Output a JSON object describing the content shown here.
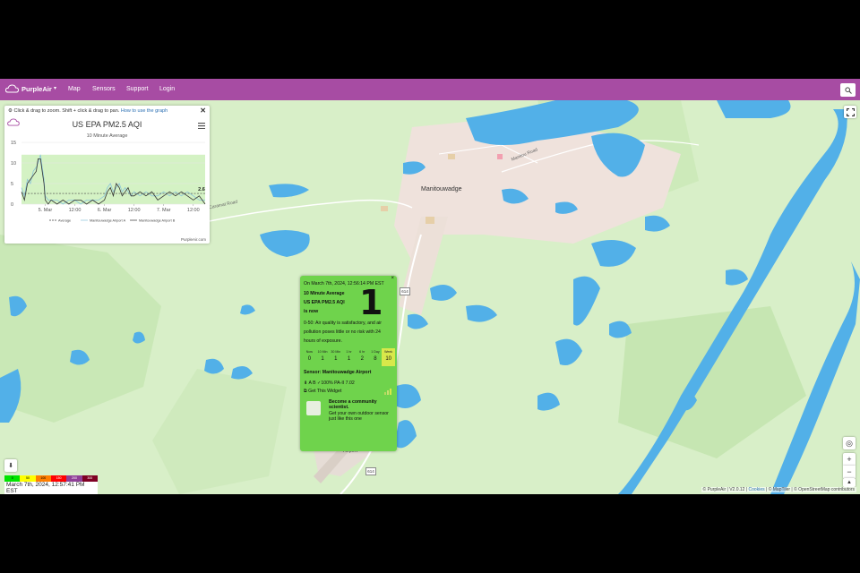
{
  "navbar": {
    "brand": "PurpleAir",
    "items": [
      "Map",
      "Sensors",
      "Support",
      "Login"
    ]
  },
  "chart_panel": {
    "hint": "Click & drag to zoom. Shift + click & drag to pan.",
    "hint_link": "How to use the graph",
    "title": "US EPA PM2.5 AQI",
    "subtitle": "10 Minute Average",
    "credit": "PurpleAir.com",
    "legend": [
      "Average",
      "Manitouwadge Airport A",
      "Manitouwadge Airport B"
    ],
    "last_value_label": "2.6"
  },
  "chart_data": {
    "type": "line",
    "title": "US EPA PM2.5 AQI",
    "subtitle": "10 Minute Average",
    "xlabel": "",
    "ylabel": "",
    "ylim": [
      0,
      15
    ],
    "yticks": [
      0,
      5,
      10,
      15
    ],
    "xticks": [
      "5. Mar",
      "12:00",
      "6. Mar",
      "12:00",
      "7. Mar",
      "12:00"
    ],
    "xlim": [
      -0.4,
      2.7
    ],
    "good_band": [
      0,
      12
    ],
    "average": 2.6,
    "series": [
      {
        "name": "Manitouwadge Airport A",
        "x": [
          -0.4,
          -0.35,
          -0.3,
          -0.25,
          -0.2,
          -0.15,
          -0.12,
          -0.08,
          -0.05,
          -0.02,
          0.0,
          0.05,
          0.1,
          0.2,
          0.3,
          0.4,
          0.5,
          0.6,
          0.7,
          0.8,
          0.9,
          1.0,
          1.05,
          1.1,
          1.15,
          1.2,
          1.25,
          1.3,
          1.35,
          1.4,
          1.45,
          1.5,
          1.6,
          1.7,
          1.8,
          1.9,
          2.0,
          2.1,
          2.2,
          2.3,
          2.4,
          2.5,
          2.6,
          2.7
        ],
        "values": [
          4,
          2,
          6,
          5,
          8,
          9,
          10,
          12,
          9,
          6,
          2,
          1,
          1,
          1,
          0,
          1,
          1,
          0,
          1,
          1,
          1,
          2,
          4,
          5,
          3,
          4,
          5,
          3,
          4,
          3,
          2,
          3,
          2,
          3,
          2,
          2,
          3,
          2,
          3,
          2,
          3,
          2,
          1,
          1
        ]
      },
      {
        "name": "Manitouwadge Airport B",
        "x": [
          -0.4,
          -0.35,
          -0.3,
          -0.25,
          -0.2,
          -0.15,
          -0.12,
          -0.08,
          -0.05,
          -0.02,
          0.0,
          0.05,
          0.1,
          0.2,
          0.3,
          0.4,
          0.5,
          0.6,
          0.7,
          0.8,
          0.9,
          1.0,
          1.05,
          1.1,
          1.15,
          1.2,
          1.25,
          1.3,
          1.35,
          1.4,
          1.45,
          1.5,
          1.6,
          1.7,
          1.8,
          1.9,
          2.0,
          2.1,
          2.2,
          2.3,
          2.4,
          2.5,
          2.6,
          2.7
        ],
        "values": [
          3,
          1,
          5,
          6,
          7,
          8,
          11,
          11,
          8,
          5,
          1,
          0,
          1,
          0,
          1,
          0,
          1,
          1,
          0,
          1,
          0,
          1,
          3,
          4,
          2,
          5,
          4,
          2,
          3,
          4,
          2,
          2,
          3,
          2,
          3,
          1,
          2,
          3,
          2,
          3,
          2,
          1,
          2,
          0
        ]
      }
    ]
  },
  "popup": {
    "timestamp": "On March 7th, 2024, 12:56:14 PM EST",
    "avg_label": "10 Minute Average",
    "metric_label": "US EPA PM2.5 AQI",
    "is_now": "is now",
    "value": "1",
    "description": "0-50: Air quality is satisfactory, and air pollution poses little or no risk with 24 hours of exposure.",
    "periods": [
      {
        "label": "Now",
        "value": "0"
      },
      {
        "label": "10 Min",
        "value": "1"
      },
      {
        "label": "30 Min",
        "value": "1"
      },
      {
        "label": "1 hr",
        "value": "1"
      },
      {
        "label": "6 hr",
        "value": "2"
      },
      {
        "label": "1 Day",
        "value": "8"
      },
      {
        "label": "Week",
        "value": "10"
      }
    ],
    "sensor": "Sensor: Manitouwadge Airport",
    "channels": "A B ✓100% PA-II 7.02",
    "widget_link": "Get This Widget",
    "community_title": "Become a community scientist.",
    "community_body": "Get your own outdoor sensor just like this one"
  },
  "marker": {
    "value": "1",
    "label": "Manitouwadge Airport"
  },
  "map_labels": {
    "town": "Manitouwadge",
    "road_caramat": "Caramat Road",
    "road_manitou": "Manitou Road",
    "highway_shield_1": "614",
    "highway_shield_2": "614"
  },
  "legend": {
    "scale": [
      "0",
      "50",
      "100",
      "150",
      "200",
      "300"
    ],
    "timestamp": "March 7th, 2024, 12:57:41 PM EST"
  },
  "attribution": {
    "prefix": "© PurpleAir | V2.0.12 |",
    "cookies": "Cookies",
    "maptiler": "| © MapTiler |",
    "osm": "© OpenStreetMap contributors"
  },
  "colors": {
    "navbar": "#a74ca3",
    "aqi_good": "#6fd34c",
    "land": "#d8efc8",
    "water": "#52b0e8",
    "town": "#efe2dc"
  },
  "icons": [
    "purpleair-cloud-icon",
    "search-icon",
    "fullscreen-icon",
    "close-icon",
    "hamburger-menu-icon",
    "locate-icon",
    "zoom-in-icon",
    "zoom-out-icon",
    "compass-icon",
    "download-icon"
  ]
}
